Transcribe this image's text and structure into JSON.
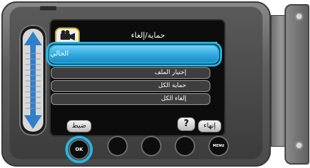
{
  "header": {
    "title": "حماية/إلغاء"
  },
  "menu": {
    "items": [
      {
        "label": "الحالي",
        "selected": true
      },
      {
        "label": "إختيار الملف",
        "selected": false
      },
      {
        "label": "حماية الكل",
        "selected": false
      },
      {
        "label": "إلغاء الكل",
        "selected": false
      }
    ]
  },
  "softkeys": {
    "set": "ضبط",
    "help": "?",
    "end": "إنهاء"
  },
  "hardkeys": {
    "ok": "OK",
    "menu": "MENU"
  },
  "colors": {
    "highlight": "#24b6e8",
    "accent_rule": "#cfae00",
    "screen_bg": "#0c0c0c"
  },
  "icons": {
    "tab": "video-camera-icon",
    "slider": "up-down-arrow-icon"
  }
}
